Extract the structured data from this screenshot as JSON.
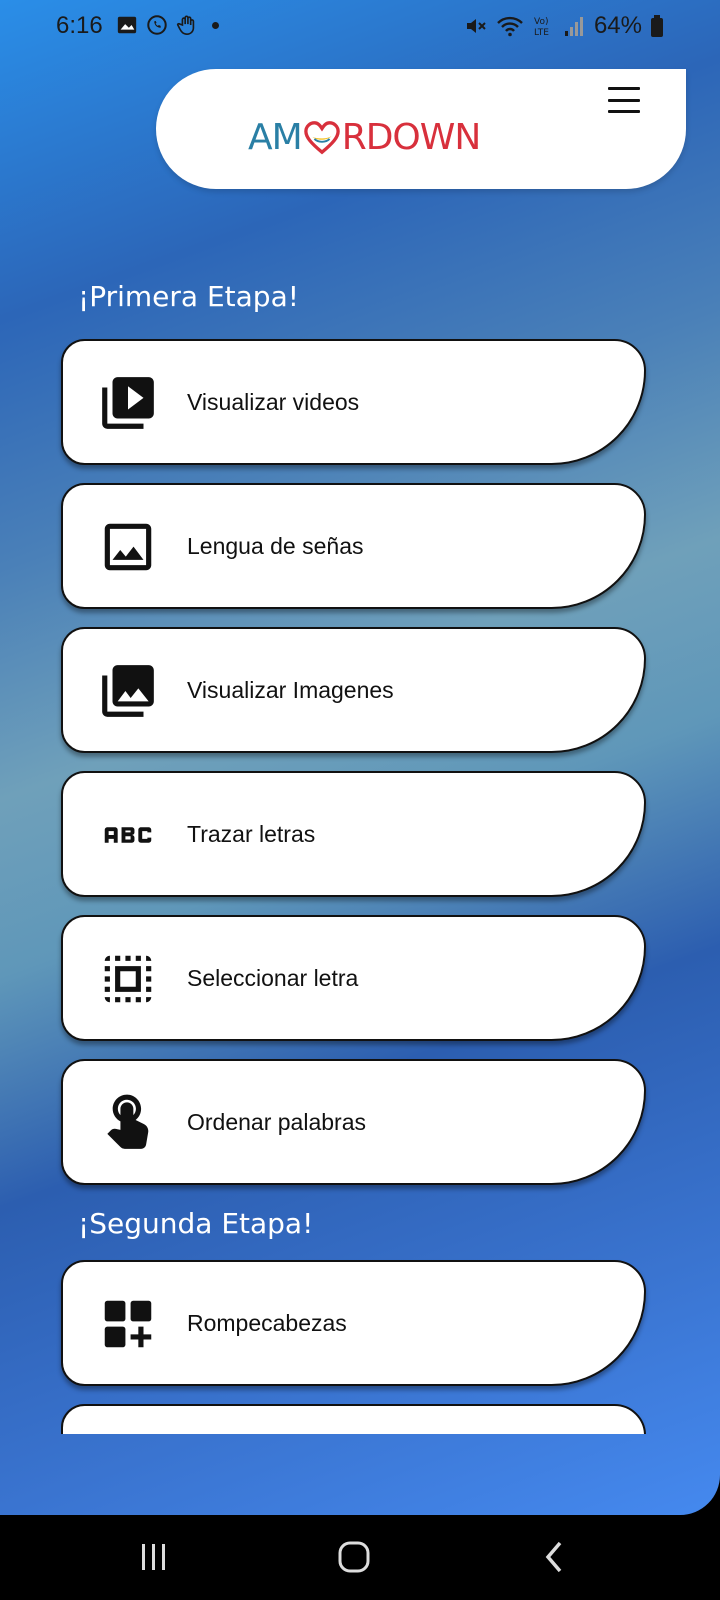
{
  "status_bar": {
    "time": "6:16",
    "battery": "64%"
  },
  "header": {
    "logo_part1": "AM",
    "logo_part2": "R",
    "logo_part3": "DOWN"
  },
  "sections": [
    {
      "title": "¡Primera Etapa!",
      "items": [
        {
          "label": "Visualizar videos",
          "icon": "video-library-icon"
        },
        {
          "label": "Lengua de señas",
          "icon": "image-icon"
        },
        {
          "label": "Visualizar Imagenes",
          "icon": "photo-library-icon"
        },
        {
          "label": "Trazar letras",
          "icon": "abc-icon"
        },
        {
          "label": "Seleccionar letra",
          "icon": "select-all-icon"
        },
        {
          "label": "Ordenar palabras",
          "icon": "touch-icon"
        }
      ]
    },
    {
      "title": "¡Segunda Etapa!",
      "items": [
        {
          "label": "Rompecabezas",
          "icon": "dashboard-add-icon"
        }
      ]
    }
  ],
  "colors": {
    "logo_blue": "#2a7fa5",
    "logo_red": "#d8303c",
    "background_primary": "#2c66b8",
    "background_accent": "#6fa0ba"
  }
}
